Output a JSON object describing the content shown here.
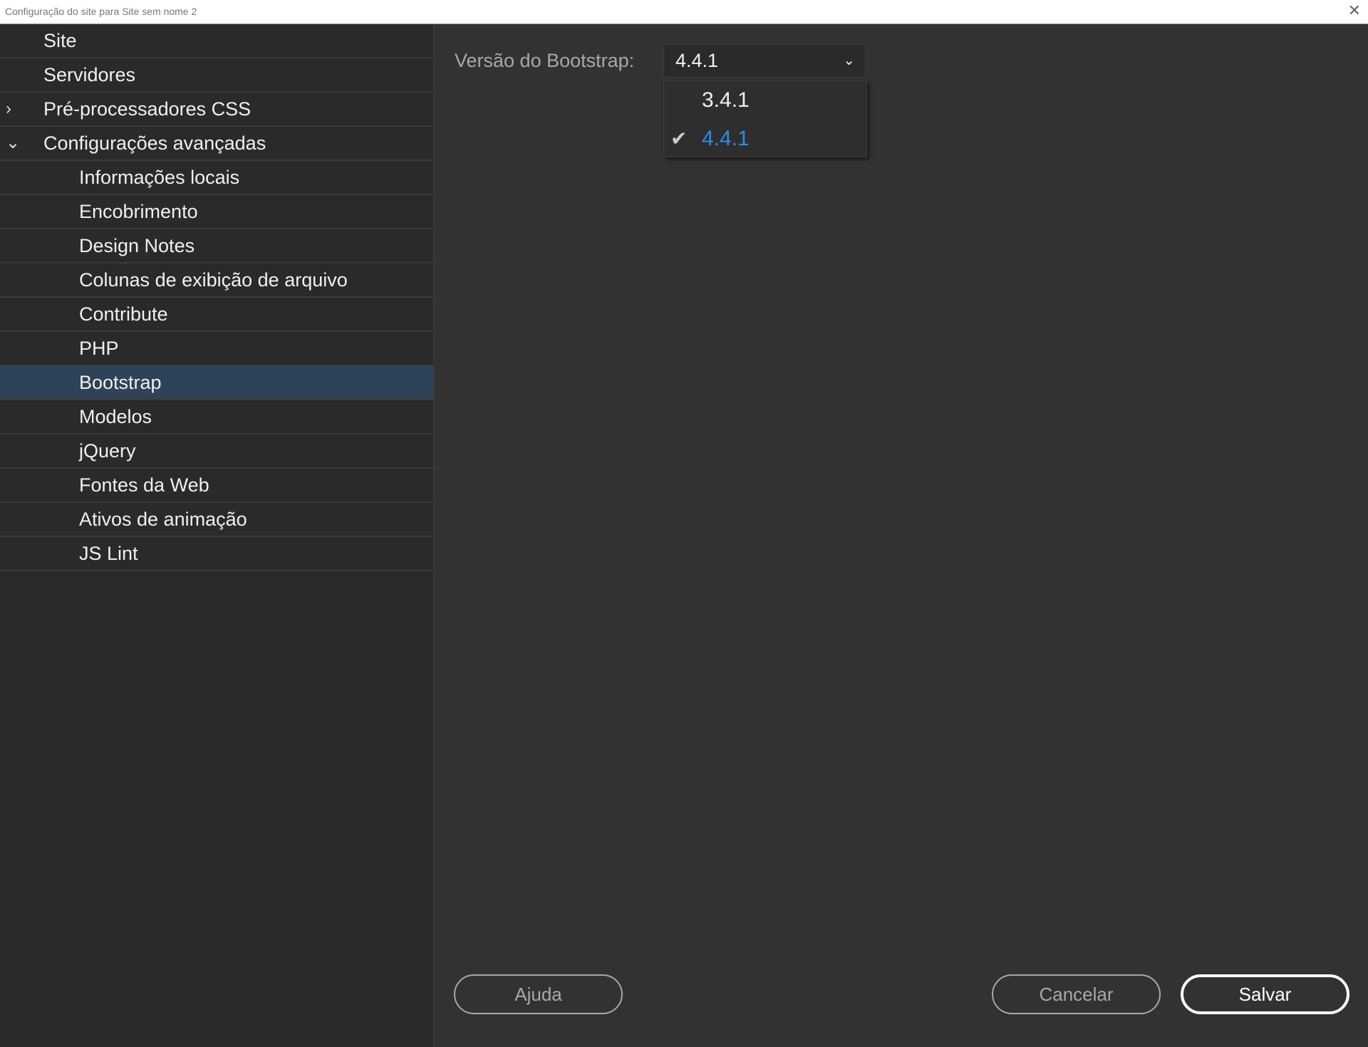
{
  "window": {
    "title": "Configuração do site para Site sem nome 2",
    "close": "✕"
  },
  "sidebar": {
    "items": [
      {
        "label": "Site",
        "level": 0,
        "chevron": ""
      },
      {
        "label": "Servidores",
        "level": 0,
        "chevron": ""
      },
      {
        "label": "Pré-processadores CSS",
        "level": 0,
        "chevron": "›"
      },
      {
        "label": "Configurações avançadas",
        "level": 0,
        "chevron": "⌄"
      },
      {
        "label": "Informações locais",
        "level": 1
      },
      {
        "label": "Encobrimento",
        "level": 1
      },
      {
        "label": "Design Notes",
        "level": 1
      },
      {
        "label": "Colunas de exibição de arquivo",
        "level": 1
      },
      {
        "label": "Contribute",
        "level": 1
      },
      {
        "label": "PHP",
        "level": 1
      },
      {
        "label": "Bootstrap",
        "level": 1,
        "selected": true
      },
      {
        "label": "Modelos",
        "level": 1
      },
      {
        "label": "jQuery",
        "level": 1
      },
      {
        "label": "Fontes da Web",
        "level": 1
      },
      {
        "label": "Ativos de animação",
        "level": 1
      },
      {
        "label": "JS Lint",
        "level": 1
      }
    ]
  },
  "main": {
    "label": "Versão do Bootstrap:",
    "selected": "4.4.1",
    "options": [
      {
        "label": "3.4.1",
        "checked": false
      },
      {
        "label": "4.4.1",
        "checked": true
      }
    ],
    "accent": "#2d8ceb"
  },
  "buttons": {
    "help": "Ajuda",
    "cancel": "Cancelar",
    "save": "Salvar"
  }
}
